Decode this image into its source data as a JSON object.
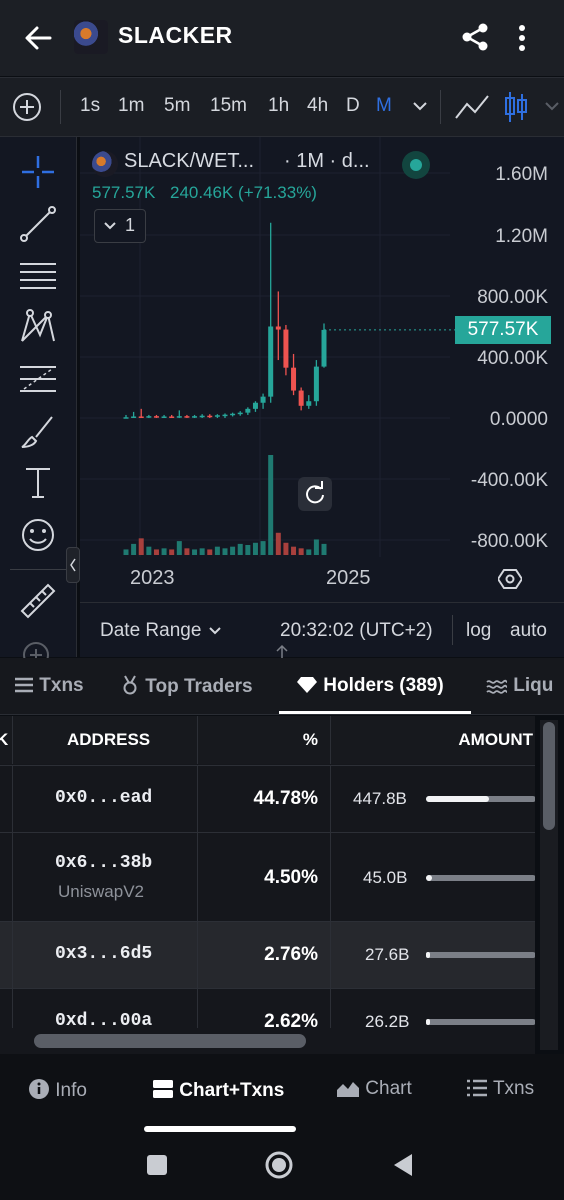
{
  "header": {
    "title": "SLACKER"
  },
  "toolbar": {
    "timeframes": [
      "1s",
      "1m",
      "5m",
      "15m",
      "1h",
      "4h",
      "D",
      "M"
    ],
    "active_timeframe": "M"
  },
  "chart": {
    "pair": "SLACK/WET...",
    "interval_suffix": "· 1M · d...",
    "last_price": "577.57K",
    "change_text": "240.46K (+71.33%)",
    "indicator_count": "1",
    "price_badge": "577.57K",
    "y_axis": [
      "1.60M",
      "1.20M",
      "800.00K",
      "400.00K",
      "0.0000",
      "-400.00K",
      "-800.00K"
    ],
    "x_axis": [
      "2023",
      "2025"
    ],
    "date_range_label": "Date Range",
    "clock": "20:32:02 (UTC+2)",
    "log_label": "log",
    "auto_label": "auto",
    "colors": {
      "up": "#26a69a",
      "down": "#ef5350",
      "accent": "#2f6fe0"
    }
  },
  "tabs": {
    "txns": "Txns",
    "top_traders": "Top Traders",
    "holders": "Holders (389)",
    "liquidity": "Liqu"
  },
  "holders_table": {
    "headers": {
      "address": "ADDRESS",
      "pct": "%",
      "amount": "AMOUNT"
    },
    "rows": [
      {
        "address": "0x0...ead",
        "label": "",
        "pct": "44.78%",
        "amount": "447.8B",
        "share": 0.4478
      },
      {
        "address": "0x6...38b",
        "label": "UniswapV2",
        "pct": "4.50%",
        "amount": "45.0B",
        "share": 0.045
      },
      {
        "address": "0x3...6d5",
        "label": "",
        "pct": "2.76%",
        "amount": "27.6B",
        "share": 0.0276
      },
      {
        "address": "0xd...00a",
        "label": "",
        "pct": "2.62%",
        "amount": "26.2B",
        "share": 0.0262
      }
    ]
  },
  "bottom_nav": {
    "info": "Info",
    "chart_txns": "Chart+Txns",
    "chart": "Chart",
    "txns": "Txns"
  },
  "chart_data": {
    "type": "candlestick",
    "x_ticks": [
      "2023",
      "2025"
    ],
    "y_ticks": [
      "1.60M",
      "1.20M",
      "800.00K",
      "400.00K",
      "0.0000",
      "-400.00K",
      "-800.00K"
    ],
    "last_value": 577570,
    "candles": [
      {
        "o": 0,
        "h": 20000,
        "l": 0,
        "c": 5000
      },
      {
        "o": 5000,
        "h": 40000,
        "l": 0,
        "c": 10000
      },
      {
        "o": 10000,
        "h": 60000,
        "l": 0,
        "c": 8000
      },
      {
        "o": 8000,
        "h": 20000,
        "l": 0,
        "c": 12000
      },
      {
        "o": 12000,
        "h": 20000,
        "l": 0,
        "c": 6000
      },
      {
        "o": 6000,
        "h": 20000,
        "l": 0,
        "c": 10000
      },
      {
        "o": 10000,
        "h": 20000,
        "l": 0,
        "c": 8000
      },
      {
        "o": 8000,
        "h": 50000,
        "l": 0,
        "c": 12000
      },
      {
        "o": 12000,
        "h": 20000,
        "l": 0,
        "c": 10000
      },
      {
        "o": 10000,
        "h": 20000,
        "l": 0,
        "c": 12000
      },
      {
        "o": 12000,
        "h": 25000,
        "l": 0,
        "c": 15000
      },
      {
        "o": 15000,
        "h": 25000,
        "l": 0,
        "c": 12000
      },
      {
        "o": 12000,
        "h": 25000,
        "l": 0,
        "c": 18000
      },
      {
        "o": 18000,
        "h": 30000,
        "l": 0,
        "c": 22000
      },
      {
        "o": 22000,
        "h": 35000,
        "l": 10000,
        "c": 28000
      },
      {
        "o": 28000,
        "h": 45000,
        "l": 15000,
        "c": 35000
      },
      {
        "o": 35000,
        "h": 70000,
        "l": 20000,
        "c": 60000
      },
      {
        "o": 60000,
        "h": 110000,
        "l": 40000,
        "c": 100000
      },
      {
        "o": 100000,
        "h": 160000,
        "l": 60000,
        "c": 140000
      },
      {
        "o": 140000,
        "h": 1280000,
        "l": 100000,
        "c": 600000
      },
      {
        "o": 600000,
        "h": 830000,
        "l": 380000,
        "c": 580000
      },
      {
        "o": 580000,
        "h": 610000,
        "l": 280000,
        "c": 330000
      },
      {
        "o": 330000,
        "h": 420000,
        "l": 150000,
        "c": 180000
      },
      {
        "o": 180000,
        "h": 200000,
        "l": 50000,
        "c": 80000
      },
      {
        "o": 80000,
        "h": 150000,
        "l": 60000,
        "c": 110000
      },
      {
        "o": 110000,
        "h": 380000,
        "l": 80000,
        "c": 337000
      },
      {
        "o": 337110,
        "h": 620000,
        "l": 330000,
        "c": 577570
      }
    ],
    "volumes": [
      10,
      20,
      30,
      15,
      10,
      12,
      10,
      25,
      12,
      10,
      12,
      10,
      15,
      12,
      15,
      20,
      18,
      22,
      25,
      180,
      40,
      22,
      15,
      12,
      10,
      28,
      20
    ]
  }
}
